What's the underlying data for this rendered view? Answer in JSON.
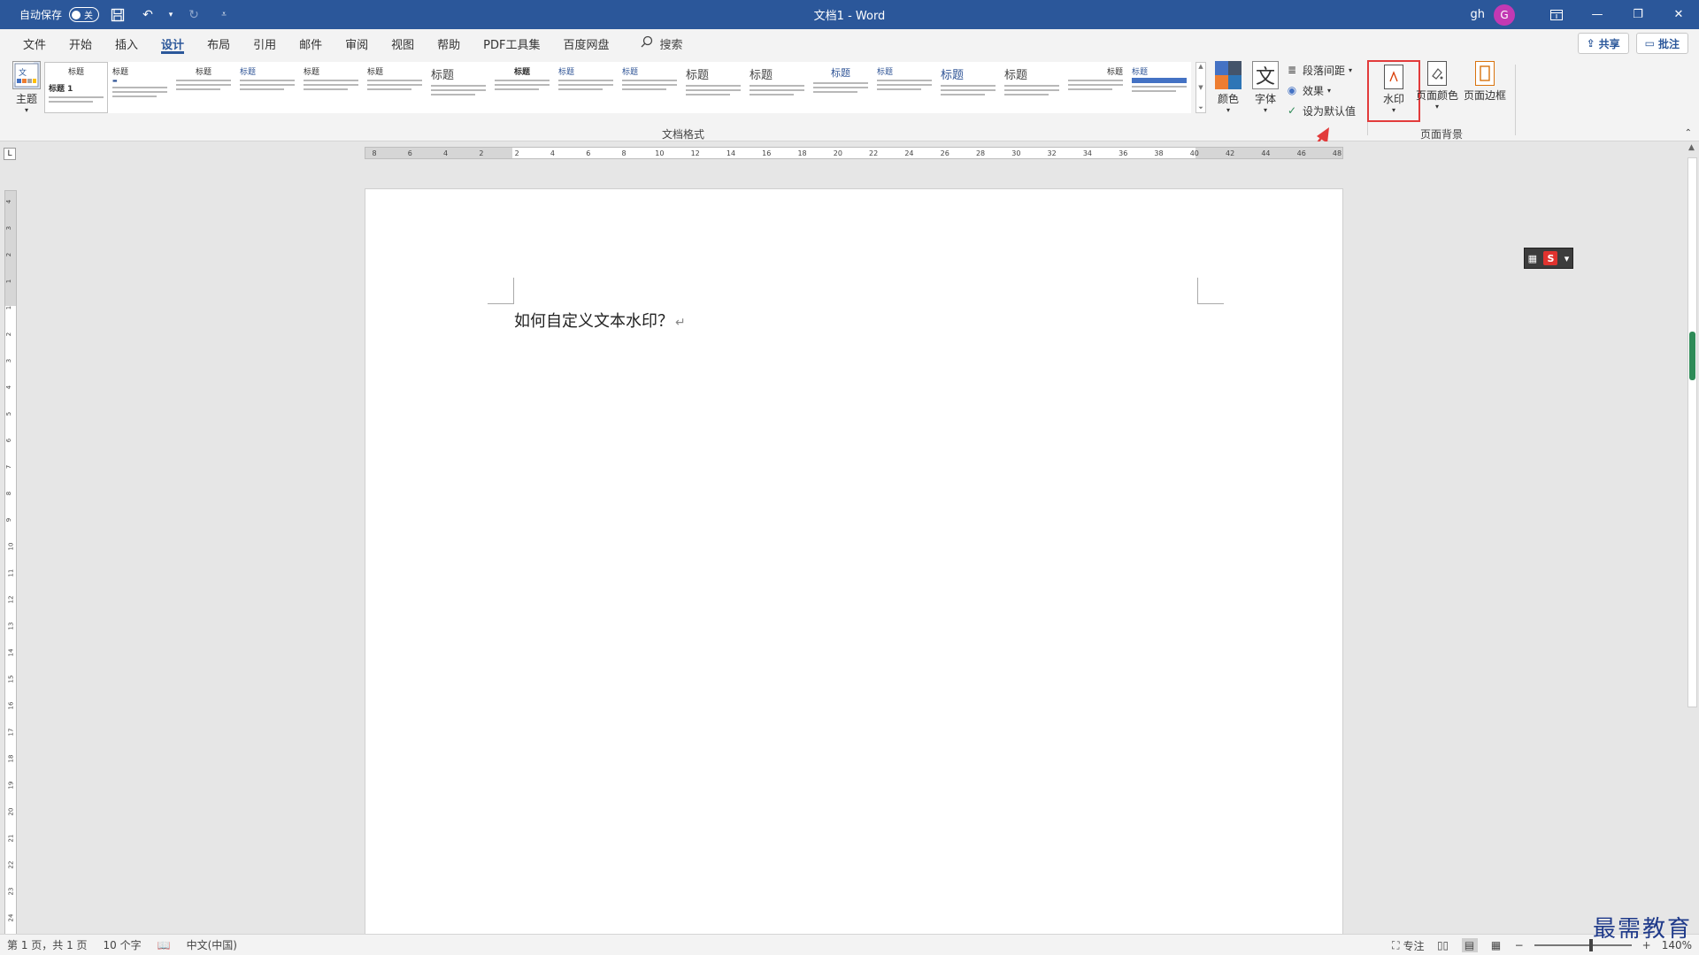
{
  "titlebar": {
    "autosave_label": "自动保存",
    "autosave_state": "关",
    "title": "文档1 - Word",
    "user": "gh",
    "avatar_letter": "G"
  },
  "tabs": [
    "文件",
    "开始",
    "插入",
    "设计",
    "布局",
    "引用",
    "邮件",
    "审阅",
    "视图",
    "帮助",
    "PDF工具集",
    "百度网盘"
  ],
  "active_tab": "设计",
  "search_label": "搜索",
  "share_label": "共享",
  "comment_label": "批注",
  "ribbon": {
    "theme_label": "主题",
    "gallery_first_title": "标题",
    "gallery_first_sub": "标题 1",
    "gallery_title_text": "标题",
    "group_doc_format": "文档格式",
    "colors_label": "颜色",
    "fonts_label": "字体",
    "font_glyph": "文",
    "paragraph_spacing": "段落间距",
    "effects": "效果",
    "set_default": "设为默认值",
    "watermark": "水印",
    "page_color": "页面颜色",
    "page_borders": "页面边框",
    "group_page_bg": "页面背景"
  },
  "ruler_h_ticks": [
    "8",
    "6",
    "4",
    "2",
    "2",
    "4",
    "6",
    "8",
    "10",
    "12",
    "14",
    "16",
    "18",
    "20",
    "22",
    "24",
    "26",
    "28",
    "30",
    "32",
    "34",
    "36",
    "38",
    "40",
    "42",
    "44",
    "46",
    "48"
  ],
  "ruler_v_ticks": [
    "4",
    "3",
    "2",
    "1",
    "1",
    "2",
    "3",
    "4",
    "5",
    "6",
    "7",
    "8",
    "9",
    "10",
    "11",
    "12",
    "13",
    "14",
    "15",
    "16",
    "17",
    "18",
    "19",
    "20",
    "21",
    "22",
    "23",
    "24"
  ],
  "document": {
    "text": "如何自定义文本水印？",
    "para_mark": "↵"
  },
  "statusbar": {
    "page": "第 1 页，共 1 页",
    "words": "10 个字",
    "language": "中文(中国)",
    "focus": "专注",
    "zoom": "140%"
  },
  "brand_watermark": "最需教育",
  "colors": {
    "accent": "#2b579a",
    "highlight_box": "#e23b3b",
    "avatar": "#c239b3"
  }
}
